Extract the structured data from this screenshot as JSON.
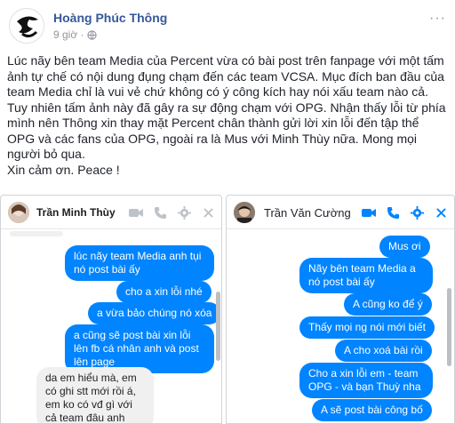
{
  "post": {
    "author": "Hoàng Phúc Thông",
    "time": "9 giờ ·",
    "more_label": "···",
    "body_lines": [
      "Lúc nãy bên team Media của Percent vừa có bài post trên fanpage với một tấm ảnh tự chế có nội dung đụng chạm đến các team VCSA. Mục đích ban đầu của team Media chỉ là vui vẻ chứ không có ý công kích hay nói xấu team nào cả. Tuy nhiên tấm ảnh này đã gây ra sự động chạm với OPG. Nhận thấy lỗi từ phía mình nên Thông xin thay mặt Percent chân thành gửi lời xin lỗi đến tập thể OPG và các fans của OPG, ngoài ra là Mus với Minh Thùy nữa. Mong mọi người bỏ qua.",
      "Xin cảm ơn. Peace !"
    ]
  },
  "chat_left": {
    "name": "Trần Minh Thùy",
    "messages_out": [
      "lúc nãy team Media anh tụi nó post bài ấy",
      "cho a xin lỗi nhé",
      "a vừa bảo chúng nó xóa",
      "a cũng sẽ post bài xin lỗi lên fb cá nhân anh và post lên page"
    ],
    "messages_in": [
      "da em hiểu mà, em có ghi stt mới rồi á, em ko có vđ gì với cả team đâu anh"
    ]
  },
  "chat_right": {
    "name": "Trần Văn Cường",
    "messages_out": [
      "Mus ơi",
      "Nãy bên team Media a nó post bài ấy",
      "A cũng ko để ý",
      "Thấy mọi ng nói mới biết",
      "A cho xoá bài rồi",
      "Cho a xin lỗi em - team OPG - và bạn Thuỳ nha",
      "A sẽ post bài công bố"
    ]
  },
  "colors": {
    "messenger_blue": "#0084ff",
    "name_blue": "#365899",
    "bubble_gray": "#f1f0f0"
  },
  "icons": [
    "video-camera-icon",
    "phone-icon",
    "gear-icon",
    "close-icon",
    "globe-icon",
    "more-icon"
  ]
}
